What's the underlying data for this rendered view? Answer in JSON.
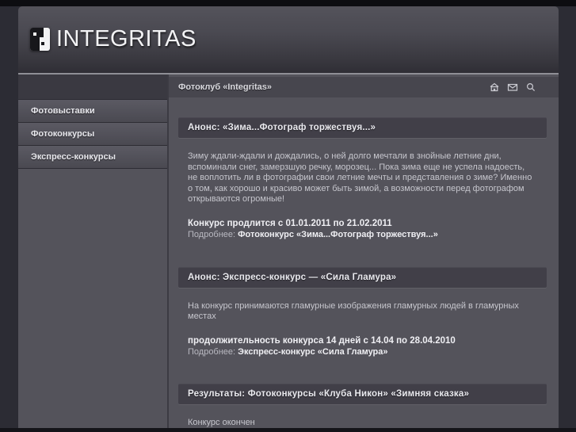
{
  "logo": {
    "text": "INTEGRITAS"
  },
  "sidebar": {
    "items": [
      {
        "label": "Фотовыставки"
      },
      {
        "label": "Фотоконкурсы"
      },
      {
        "label": "Экспресс-конкурсы"
      }
    ]
  },
  "content": {
    "topbar": {
      "title": "Фотоклуб «Integritas»",
      "icons": [
        "home-icon",
        "mail-icon",
        "search-icon"
      ]
    },
    "sections": [
      {
        "title": "Анонс: «Зима...Фотограф торжествуя...»",
        "body": "Зиму ждали-ждали и дождались, о ней долго мечтали в знойные летние дни, вспоминали снег, замерзшую речку, морозец... Пока зима еще не успела надоесть, не воплотить ли в фотографии свои летние мечты и представления о зиме? Именно о том, как хорошо и красиво может быть зимой, а возможности перед фотографом открываются огромные!",
        "highlight": "Конкурс продлится с 01.01.2011 по 21.02.2011",
        "more_label": "Подробнее:",
        "more_link": "Фотоконкурс «Зима...Фотограф торжествуя...»"
      },
      {
        "title": "Анонс: Экспресс-конкурс — «Сила Гламура»",
        "body": "На конкурс принимаются гламурные изображения гламурных людей в гламурных местах",
        "highlight": "продолжительность конкурса 14 дней с 14.04 по 28.04.2010",
        "more_label": "Подробнее:",
        "more_link": "Экспресс-конкурс «Сила Гламура»"
      },
      {
        "title": "Результаты: Фотоконкурсы «Клуба Никон» «Зимняя сказка»",
        "body": "Конкурс окончен"
      }
    ]
  },
  "colors": {
    "page_background": "#2c2c34",
    "band": "#0d0d11",
    "body_background": "#54535b",
    "menu_background": "#3a3941",
    "panel_header": "#413f48",
    "topbar": "#47464e",
    "text": "#c6c6cd",
    "text_bright": "#efeff3"
  }
}
